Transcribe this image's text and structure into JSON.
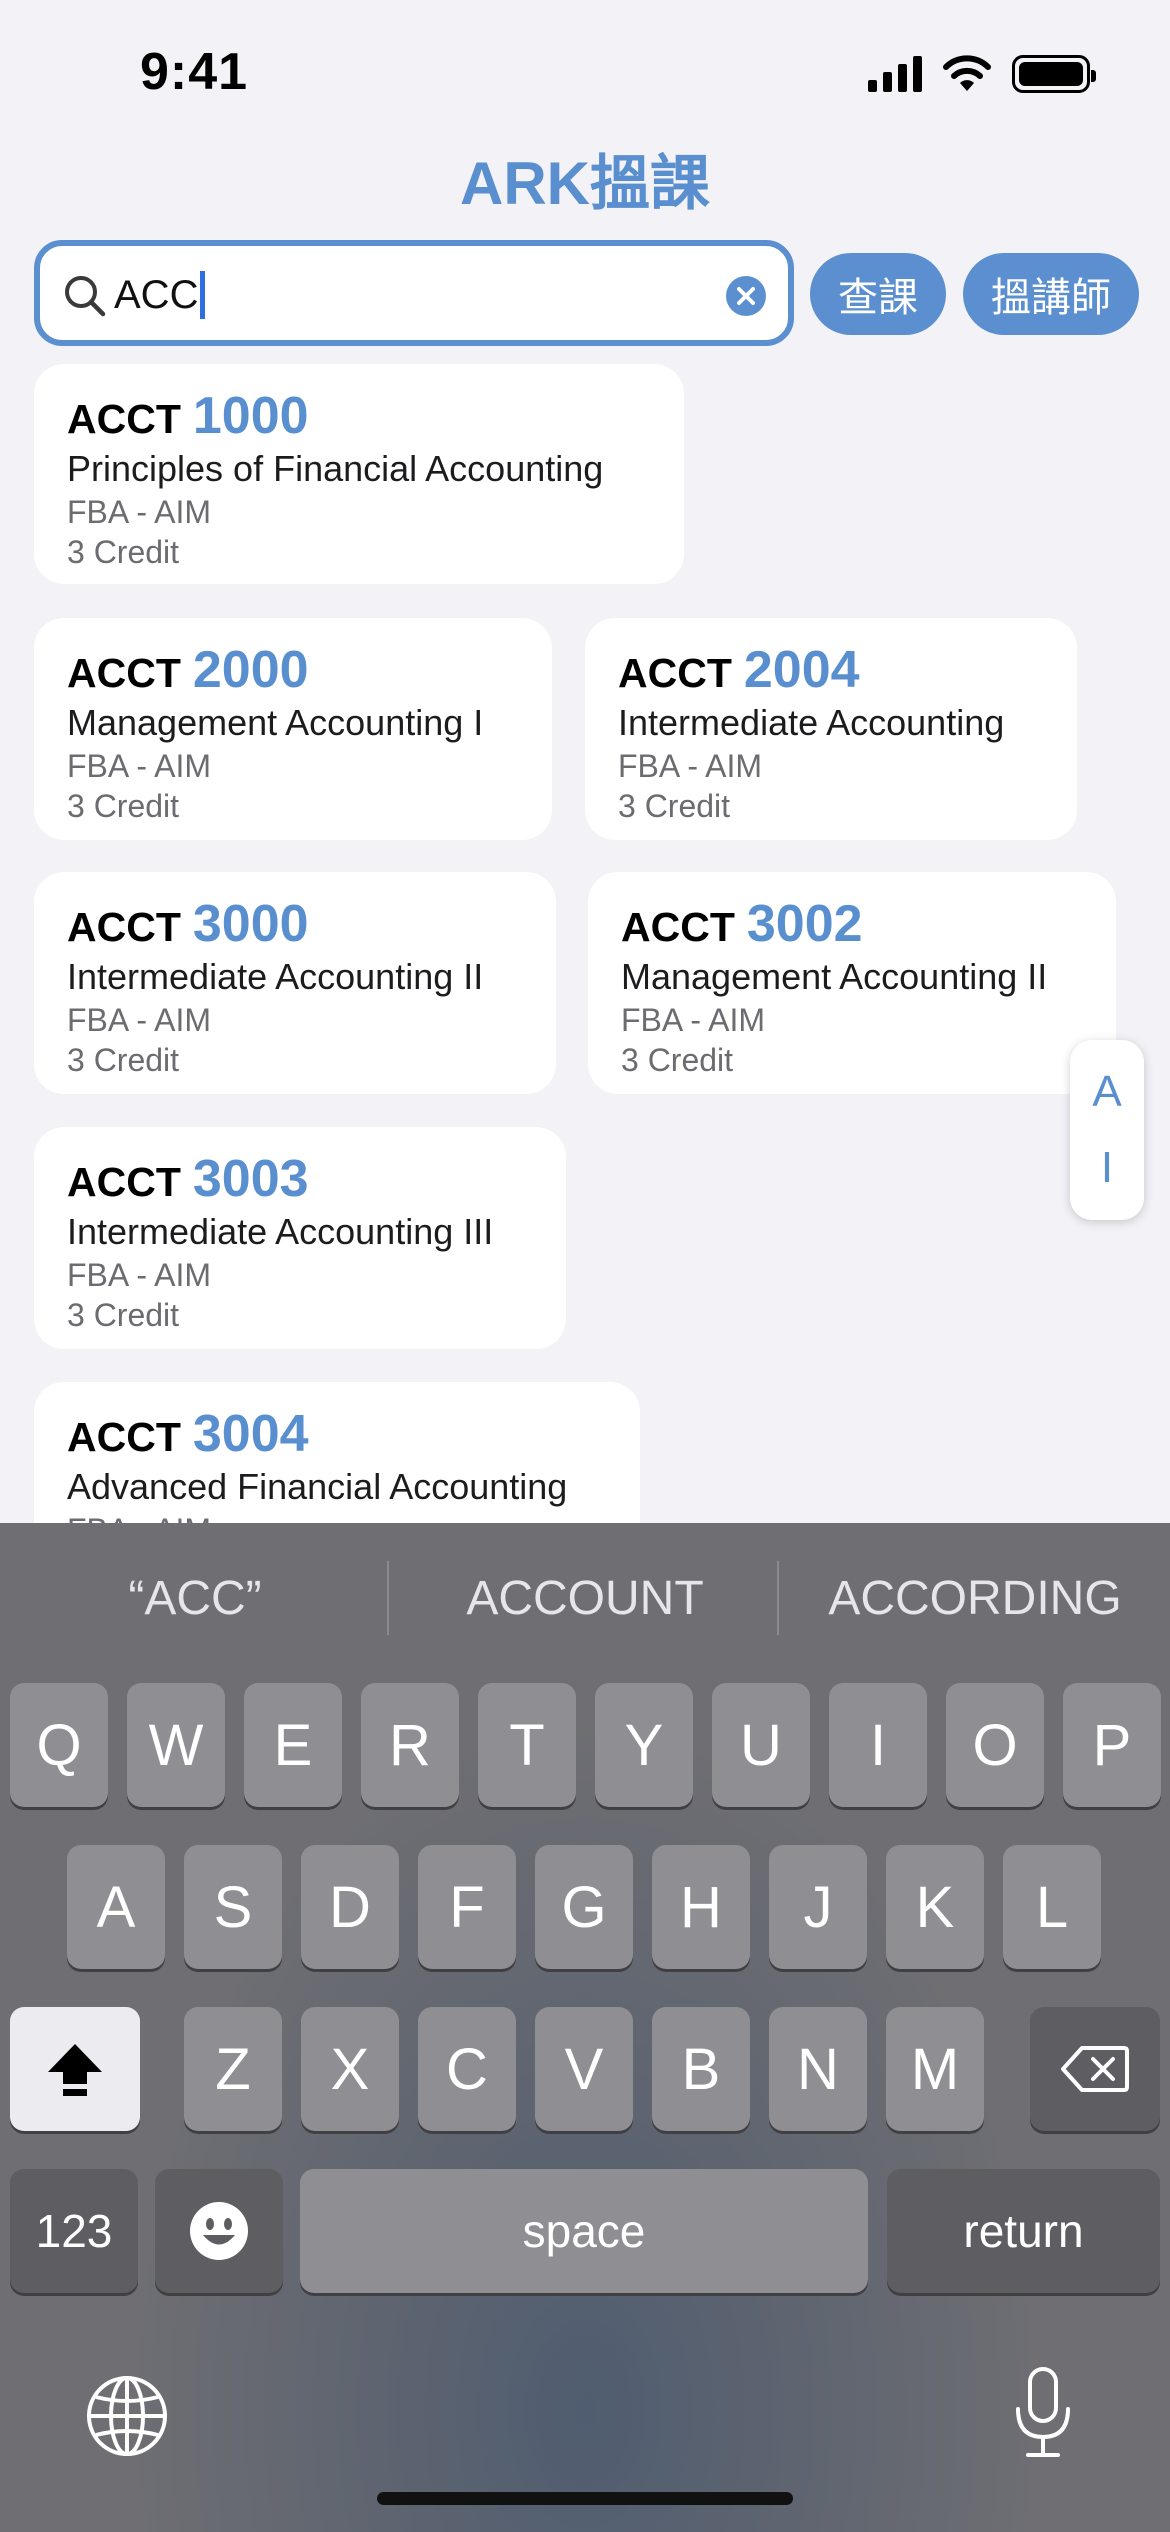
{
  "status": {
    "time": "9:41"
  },
  "app": {
    "title": "ARK搵課"
  },
  "search": {
    "value": "ACC",
    "query_button": "查課",
    "teacher_button": "搵講師"
  },
  "courses": [
    {
      "dept": "ACCT",
      "num": "1000",
      "name": "Principles of Financial Accounting",
      "school": "FBA - AIM",
      "credit": "3 Credit"
    },
    {
      "dept": "ACCT",
      "num": "2000",
      "name": "Management Accounting I",
      "school": "FBA - AIM",
      "credit": "3 Credit"
    },
    {
      "dept": "ACCT",
      "num": "2004",
      "name": "Intermediate Accounting",
      "school": "FBA - AIM",
      "credit": "3 Credit"
    },
    {
      "dept": "ACCT",
      "num": "3000",
      "name": "Intermediate Accounting II",
      "school": "FBA - AIM",
      "credit": "3 Credit"
    },
    {
      "dept": "ACCT",
      "num": "3002",
      "name": "Management Accounting II",
      "school": "FBA - AIM",
      "credit": "3 Credit"
    },
    {
      "dept": "ACCT",
      "num": "3003",
      "name": "Intermediate Accounting III",
      "school": "FBA - AIM",
      "credit": "3 Credit"
    },
    {
      "dept": "ACCT",
      "num": "3004",
      "name": "Advanced Financial Accounting",
      "school": "FBA - AIM",
      "credit": ""
    }
  ],
  "index_bar": [
    "A",
    "I"
  ],
  "keyboard": {
    "suggestions": [
      "“ACC”",
      "ACCOUNT",
      "ACCORDING"
    ],
    "row1": [
      "Q",
      "W",
      "E",
      "R",
      "T",
      "Y",
      "U",
      "I",
      "O",
      "P"
    ],
    "row2": [
      "A",
      "S",
      "D",
      "F",
      "G",
      "H",
      "J",
      "K",
      "L"
    ],
    "row3": [
      "Z",
      "X",
      "C",
      "V",
      "B",
      "N",
      "M"
    ],
    "numbers_key": "123",
    "space_key": "space",
    "return_key": "return"
  },
  "colors": {
    "accent": "#5a8fcf",
    "background": "#f2f2f7",
    "keyboard": "#6e6e73"
  }
}
